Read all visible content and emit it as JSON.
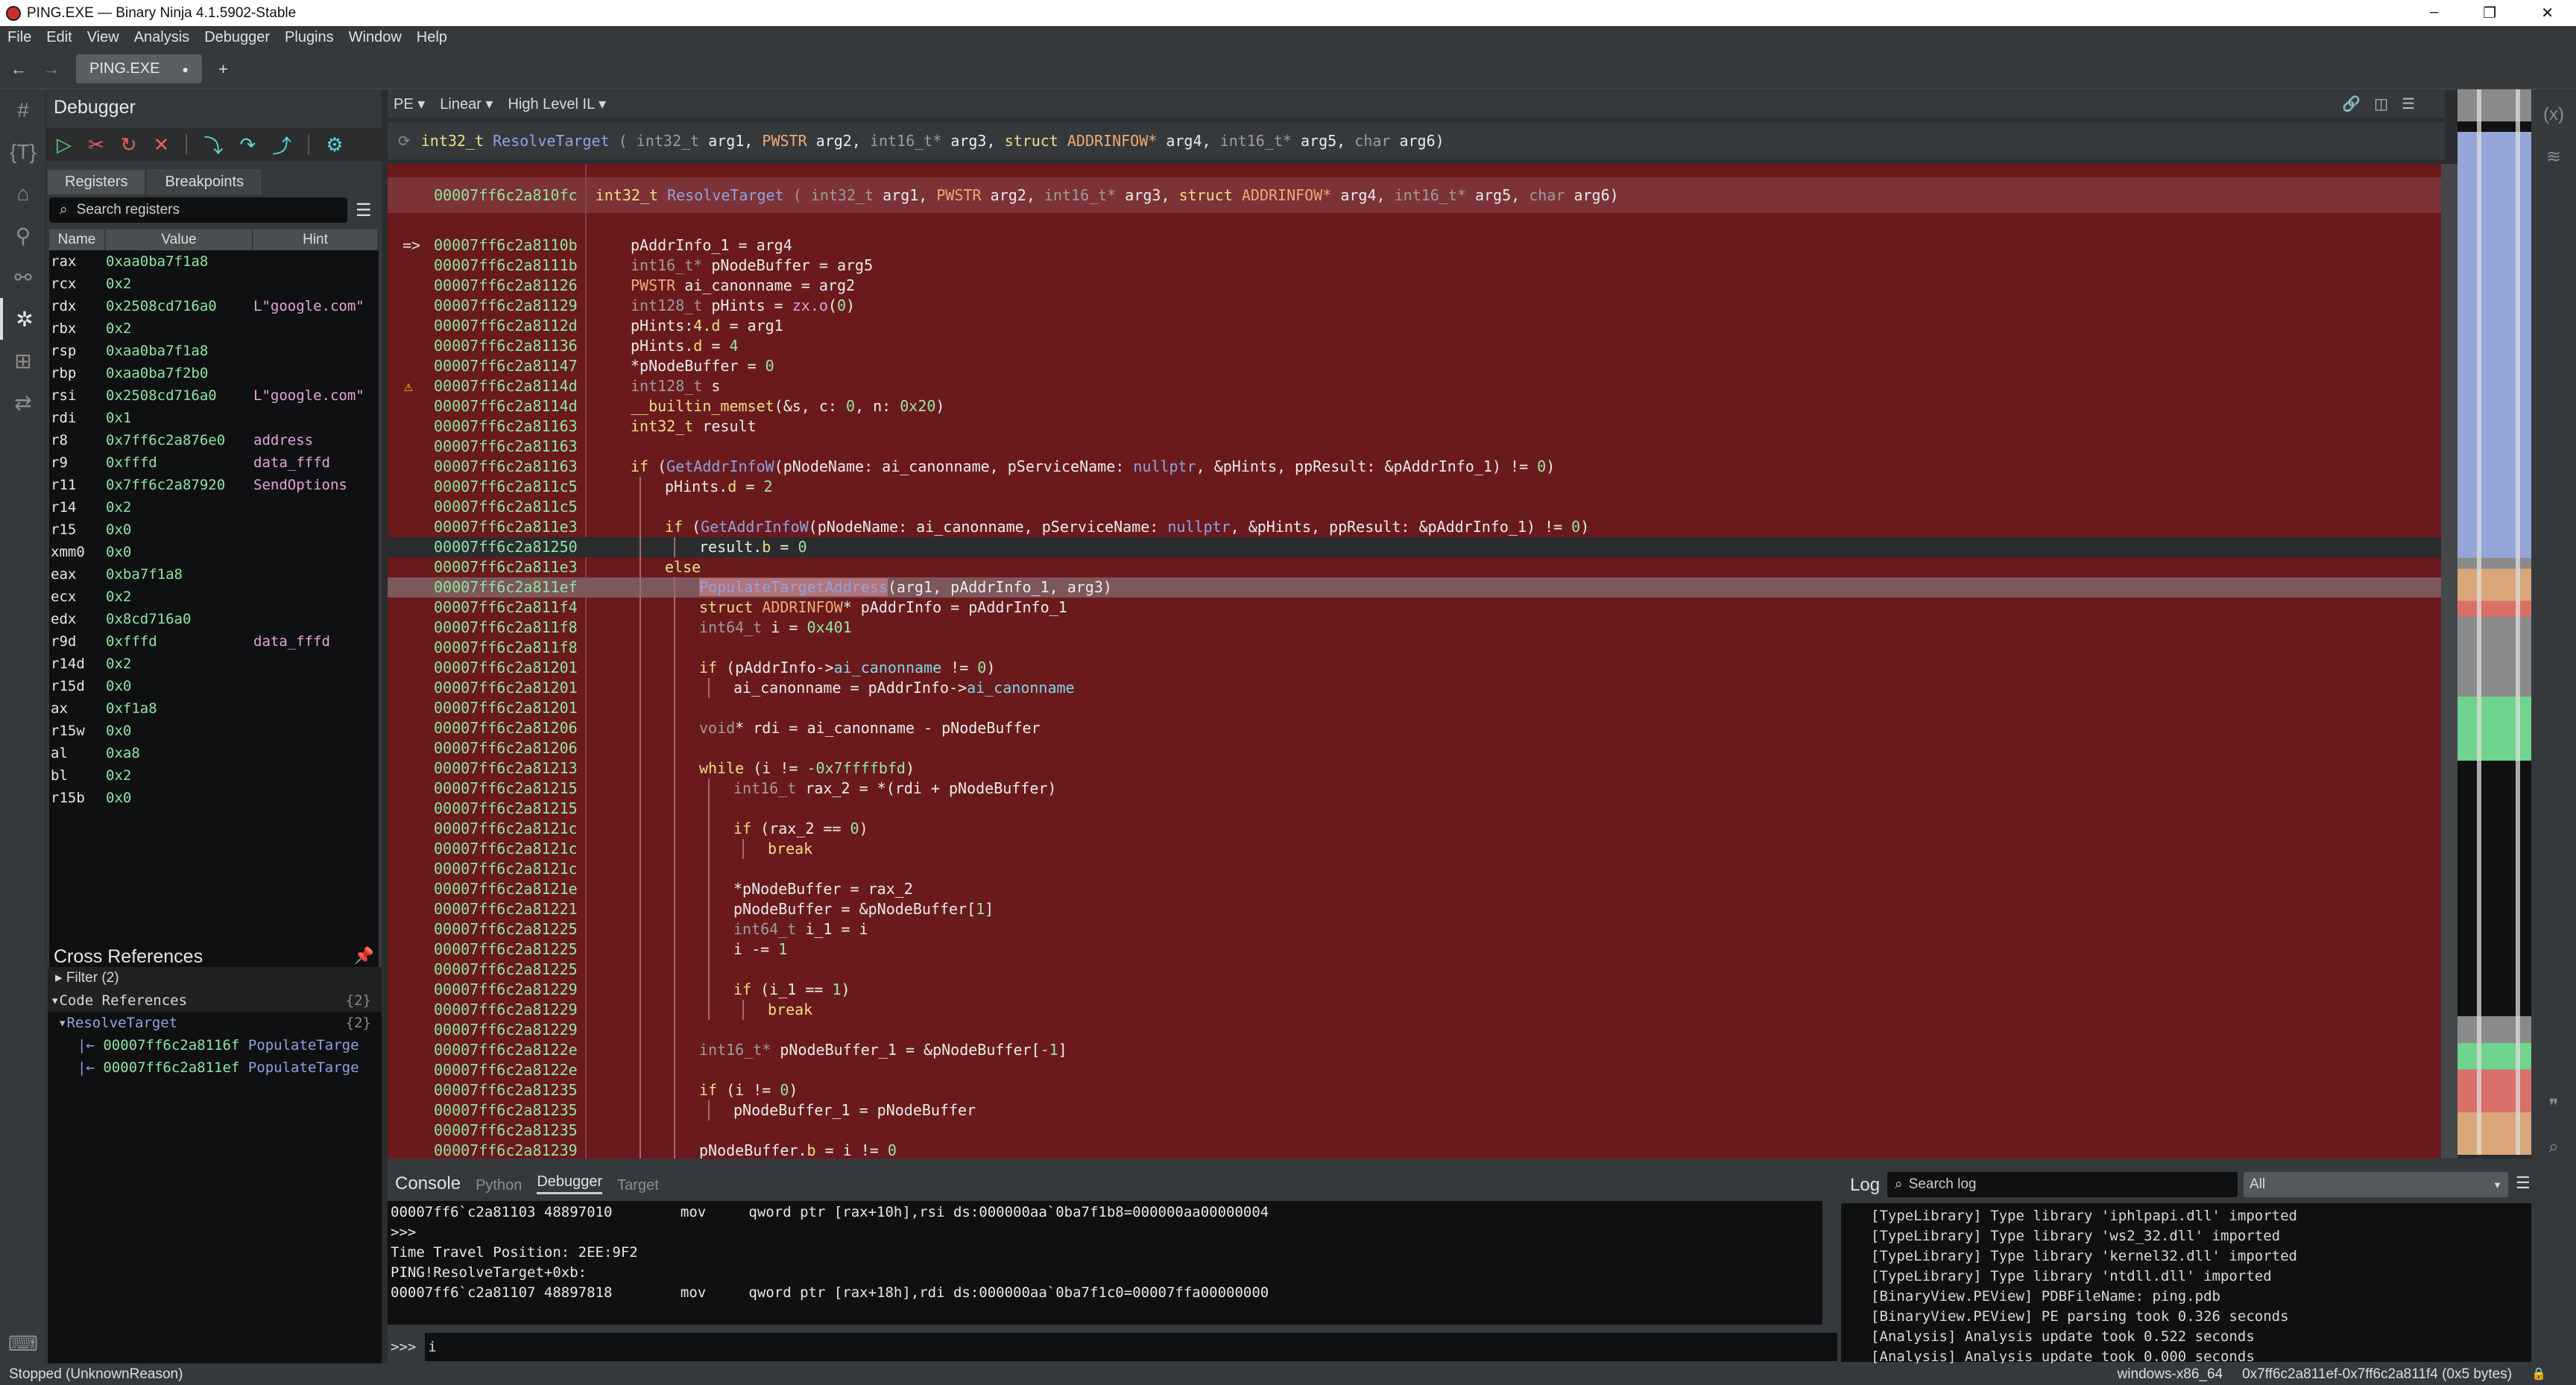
{
  "window": {
    "title": "PING.EXE — Binary Ninja 4.1.5902-Stable",
    "controls": [
      "–",
      "❐",
      "✕"
    ]
  },
  "menu": [
    "File",
    "Edit",
    "View",
    "Analysis",
    "Debugger",
    "Plugins",
    "Window",
    "Help"
  ],
  "tabs": {
    "back": "←",
    "forward": "→",
    "file_tab": "PING.EXE",
    "modified_dot": "●",
    "new_tab": "+"
  },
  "sidebar_icons": [
    "#",
    "{T}",
    "⌂",
    "⚲",
    "⚯",
    "✲",
    "⊞",
    "⇄"
  ],
  "debugger": {
    "title": "Debugger",
    "toolbar": [
      {
        "name": "resume",
        "glyph": "▷",
        "color": "#5fd07a"
      },
      {
        "name": "detach",
        "glyph": "✂",
        "color": "#e8625a"
      },
      {
        "name": "restart",
        "glyph": "↻",
        "color": "#e8625a"
      },
      {
        "name": "stop",
        "glyph": "✕",
        "color": "#e8625a"
      },
      {
        "name": "step-into",
        "glyph": "⤵",
        "color": "#58d8d8"
      },
      {
        "name": "step-over",
        "glyph": "↷",
        "color": "#58d8d8"
      },
      {
        "name": "step-return",
        "glyph": "⤴",
        "color": "#58d8d8"
      },
      {
        "name": "settings",
        "glyph": "⚙",
        "color": "#58d8d8"
      }
    ],
    "tabs": [
      "Registers",
      "Breakpoints"
    ],
    "search_placeholder": "Search registers",
    "columns": [
      "Name",
      "Value",
      "Hint"
    ],
    "registers": [
      [
        "rax",
        "0xaa0ba7f1a8",
        ""
      ],
      [
        "rcx",
        "0x2",
        ""
      ],
      [
        "rdx",
        "0x2508cd716a0",
        "L\"google.com\""
      ],
      [
        "rbx",
        "0x2",
        ""
      ],
      [
        "rsp",
        "0xaa0ba7f1a8",
        ""
      ],
      [
        "rbp",
        "0xaa0ba7f2b0",
        ""
      ],
      [
        "rsi",
        "0x2508cd716a0",
        "L\"google.com\""
      ],
      [
        "rdi",
        "0x1",
        ""
      ],
      [
        "r8",
        "0x7ff6c2a876e0",
        "address"
      ],
      [
        "r9",
        "0xfffd",
        "data_fffd"
      ],
      [
        "r11",
        "0x7ff6c2a87920",
        "SendOptions"
      ],
      [
        "r14",
        "0x2",
        ""
      ],
      [
        "r15",
        "0x0",
        ""
      ],
      [
        "xmm0",
        "0x0",
        ""
      ],
      [
        "eax",
        "0xba7f1a8",
        ""
      ],
      [
        "ecx",
        "0x2",
        ""
      ],
      [
        "edx",
        "0x8cd716a0",
        ""
      ],
      [
        "r9d",
        "0xfffd",
        "data_fffd"
      ],
      [
        "r14d",
        "0x2",
        ""
      ],
      [
        "r15d",
        "0x0",
        ""
      ],
      [
        "ax",
        "0xf1a8",
        ""
      ],
      [
        "r15w",
        "0x0",
        ""
      ],
      [
        "al",
        "0xa8",
        ""
      ],
      [
        "bl",
        "0x2",
        ""
      ],
      [
        "r15b",
        "0x0",
        ""
      ]
    ]
  },
  "xrefs": {
    "title": "Cross References",
    "filter": "Filter (2)",
    "code_refs": "Code References",
    "code_refs_count": "{2}",
    "function": "ResolveTarget",
    "function_count": "{2}",
    "items": [
      {
        "addr": "00007ff6c2a8116f",
        "name": "PopulateTarge"
      },
      {
        "addr": "00007ff6c2a811ef",
        "name": "PopulateTarge"
      }
    ]
  },
  "view": {
    "selectors": [
      "PE ▾",
      "Linear ▾",
      "High Level IL ▾"
    ],
    "signature": [
      [
        "k",
        "int32_t"
      ],
      [
        "f",
        "ResolveTarget"
      ],
      [
        "t",
        "("
      ],
      [
        "t",
        "int32_t"
      ],
      [
        "p",
        "arg1,"
      ],
      [
        "s",
        "PWSTR"
      ],
      [
        "p",
        "arg2,"
      ],
      [
        "t",
        "int16_t*"
      ],
      [
        "p",
        "arg3,"
      ],
      [
        "k",
        "struct"
      ],
      [
        "s",
        "ADDRINFOW*"
      ],
      [
        "p",
        "arg4,"
      ],
      [
        "t",
        "int16_t*"
      ],
      [
        "p",
        "arg5,"
      ],
      [
        "t",
        "char"
      ],
      [
        "p",
        "arg6)"
      ]
    ],
    "header_addr": "00007ff6c2a810fc",
    "colors": {
      "background": "#6a1a1d",
      "address": "#8ee5a2",
      "keyword": "#eedf86",
      "function": "#8fa3e2"
    }
  },
  "code": [
    {
      "a": "00007ff6c2a8110b",
      "i": 0,
      "mk": "=>",
      "tk": [
        [
          "p",
          "pAddrInfo_1 = arg4"
        ]
      ]
    },
    {
      "a": "00007ff6c2a8111b",
      "i": 0,
      "tk": [
        [
          "t",
          "int16_t* "
        ],
        [
          "p",
          "pNodeBuffer = arg5"
        ]
      ]
    },
    {
      "a": "00007ff6c2a81126",
      "i": 0,
      "tk": [
        [
          "s",
          "PWSTR "
        ],
        [
          "p",
          "ai_canonname = arg2"
        ]
      ]
    },
    {
      "a": "00007ff6c2a81129",
      "i": 0,
      "tk": [
        [
          "t",
          "int128_t "
        ],
        [
          "p",
          "pHints = "
        ],
        [
          "z",
          "zx.o"
        ],
        [
          "p",
          "("
        ],
        [
          "n",
          "0"
        ],
        [
          "p",
          ")"
        ]
      ]
    },
    {
      "a": "00007ff6c2a8112d",
      "i": 0,
      "tk": [
        [
          "p",
          "pHints:"
        ],
        [
          "m",
          "4.d"
        ],
        [
          "p",
          " = arg1"
        ]
      ]
    },
    {
      "a": "00007ff6c2a81136",
      "i": 0,
      "tk": [
        [
          "p",
          "pHints."
        ],
        [
          "m",
          "d"
        ],
        [
          "p",
          " = "
        ],
        [
          "n",
          "4"
        ]
      ]
    },
    {
      "a": "00007ff6c2a81147",
      "i": 0,
      "tk": [
        [
          "p",
          "*pNodeBuffer = "
        ],
        [
          "n",
          "0"
        ]
      ]
    },
    {
      "a": "00007ff6c2a8114d",
      "i": 0,
      "mk": "⚠",
      "tk": [
        [
          "t",
          "int128_t "
        ],
        [
          "p",
          "s"
        ]
      ]
    },
    {
      "a": "00007ff6c2a8114d",
      "i": 0,
      "tk": [
        [
          "k",
          "__builtin_memset"
        ],
        [
          "p",
          "(&s, c: "
        ],
        [
          "n",
          "0"
        ],
        [
          "p",
          ", n: "
        ],
        [
          "n",
          "0x20"
        ],
        [
          "p",
          ")"
        ]
      ]
    },
    {
      "a": "00007ff6c2a81163",
      "i": 0,
      "tk": [
        [
          "k",
          "int32_t "
        ],
        [
          "p",
          "result"
        ]
      ]
    },
    {
      "a": "00007ff6c2a81163",
      "i": 0,
      "tk": []
    },
    {
      "a": "00007ff6c2a81163",
      "i": 0,
      "tk": [
        [
          "k",
          "if "
        ],
        [
          "p",
          "("
        ],
        [
          "f",
          "GetAddrInfoW"
        ],
        [
          "p",
          "(pNodeName: ai_canonname, pServiceName: "
        ],
        [
          "f",
          "nullptr"
        ],
        [
          "p",
          ", &pHints, ppResult: &pAddrInfo_1) != "
        ],
        [
          "n",
          "0"
        ],
        [
          "p",
          ")"
        ]
      ]
    },
    {
      "a": "00007ff6c2a811c5",
      "i": 1,
      "tk": [
        [
          "p",
          "pHints."
        ],
        [
          "m",
          "d"
        ],
        [
          "p",
          " = "
        ],
        [
          "n",
          "2"
        ]
      ]
    },
    {
      "a": "00007ff6c2a811c5",
      "i": 1,
      "tk": []
    },
    {
      "a": "00007ff6c2a811e3",
      "i": 1,
      "tk": [
        [
          "k",
          "if "
        ],
        [
          "p",
          "("
        ],
        [
          "f",
          "GetAddrInfoW"
        ],
        [
          "p",
          "(pNodeName: ai_canonname, pServiceName: "
        ],
        [
          "f",
          "nullptr"
        ],
        [
          "p",
          ", &pHints, ppResult: &pAddrInfo_1) != "
        ],
        [
          "n",
          "0"
        ],
        [
          "p",
          ")"
        ]
      ]
    },
    {
      "a": "00007ff6c2a81250",
      "i": 2,
      "st": "cur",
      "tk": [
        [
          "p",
          "result."
        ],
        [
          "m",
          "b"
        ],
        [
          "p",
          " = "
        ],
        [
          "n",
          "0"
        ]
      ]
    },
    {
      "a": "00007ff6c2a811e3",
      "i": 1,
      "tk": [
        [
          "k",
          "else"
        ]
      ]
    },
    {
      "a": "00007ff6c2a811ef",
      "i": 2,
      "st": "sel",
      "tk": [
        [
          "f",
          "PopulateTargetAddress"
        ],
        [
          "p",
          "(arg1, pAddrInfo_1, arg3)"
        ]
      ]
    },
    {
      "a": "00007ff6c2a811f4",
      "i": 2,
      "tk": [
        [
          "k",
          "struct "
        ],
        [
          "s",
          "ADDRINFOW"
        ],
        [
          "p",
          "* pAddrInfo = pAddrInfo_1"
        ]
      ]
    },
    {
      "a": "00007ff6c2a811f8",
      "i": 2,
      "tk": [
        [
          "t",
          "int64_t "
        ],
        [
          "p",
          "i = "
        ],
        [
          "n",
          "0x401"
        ]
      ]
    },
    {
      "a": "00007ff6c2a811f8",
      "i": 2,
      "tk": []
    },
    {
      "a": "00007ff6c2a81201",
      "i": 2,
      "tk": [
        [
          "k",
          "if "
        ],
        [
          "p",
          "(pAddrInfo->"
        ],
        [
          "c",
          "ai_canonname"
        ],
        [
          "p",
          " != "
        ],
        [
          "n",
          "0"
        ],
        [
          "p",
          ")"
        ]
      ]
    },
    {
      "a": "00007ff6c2a81201",
      "i": 3,
      "tk": [
        [
          "p",
          "ai_canonname = pAddrInfo->"
        ],
        [
          "c",
          "ai_canonname"
        ]
      ]
    },
    {
      "a": "00007ff6c2a81201",
      "i": 2,
      "tk": []
    },
    {
      "a": "00007ff6c2a81206",
      "i": 2,
      "tk": [
        [
          "t",
          "void"
        ],
        [
          "p",
          "* rdi = ai_canonname - pNodeBuffer"
        ]
      ]
    },
    {
      "a": "00007ff6c2a81206",
      "i": 2,
      "tk": []
    },
    {
      "a": "00007ff6c2a81213",
      "i": 2,
      "tk": [
        [
          "k",
          "while "
        ],
        [
          "p",
          "(i != "
        ],
        [
          "n",
          "-0x7ffffbfd"
        ],
        [
          "p",
          ")"
        ]
      ]
    },
    {
      "a": "00007ff6c2a81215",
      "i": 3,
      "tk": [
        [
          "t",
          "int16_t "
        ],
        [
          "p",
          "rax_2 = *(rdi + pNodeBuffer)"
        ]
      ]
    },
    {
      "a": "00007ff6c2a81215",
      "i": 3,
      "tk": []
    },
    {
      "a": "00007ff6c2a8121c",
      "i": 3,
      "tk": [
        [
          "k",
          "if "
        ],
        [
          "p",
          "(rax_2 == "
        ],
        [
          "n",
          "0"
        ],
        [
          "p",
          ")"
        ]
      ]
    },
    {
      "a": "00007ff6c2a8121c",
      "i": 4,
      "tk": [
        [
          "k",
          "break"
        ]
      ]
    },
    {
      "a": "00007ff6c2a8121c",
      "i": 3,
      "tk": []
    },
    {
      "a": "00007ff6c2a8121e",
      "i": 3,
      "tk": [
        [
          "p",
          "*pNodeBuffer = rax_2"
        ]
      ]
    },
    {
      "a": "00007ff6c2a81221",
      "i": 3,
      "tk": [
        [
          "p",
          "pNodeBuffer = &pNodeBuffer["
        ],
        [
          "n",
          "1"
        ],
        [
          "p",
          "]"
        ]
      ]
    },
    {
      "a": "00007ff6c2a81225",
      "i": 3,
      "tk": [
        [
          "t",
          "int64_t "
        ],
        [
          "p",
          "i_1 = i"
        ]
      ]
    },
    {
      "a": "00007ff6c2a81225",
      "i": 3,
      "tk": [
        [
          "p",
          "i -= "
        ],
        [
          "n",
          "1"
        ]
      ]
    },
    {
      "a": "00007ff6c2a81225",
      "i": 3,
      "tk": []
    },
    {
      "a": "00007ff6c2a81229",
      "i": 3,
      "tk": [
        [
          "k",
          "if "
        ],
        [
          "p",
          "(i_1 == "
        ],
        [
          "n",
          "1"
        ],
        [
          "p",
          ")"
        ]
      ]
    },
    {
      "a": "00007ff6c2a81229",
      "i": 4,
      "tk": [
        [
          "k",
          "break"
        ]
      ]
    },
    {
      "a": "00007ff6c2a81229",
      "i": 2,
      "tk": []
    },
    {
      "a": "00007ff6c2a8122e",
      "i": 2,
      "tk": [
        [
          "t",
          "int16_t* "
        ],
        [
          "p",
          "pNodeBuffer_1 = &pNodeBuffer["
        ],
        [
          "n",
          "-1"
        ],
        [
          "p",
          "]"
        ]
      ]
    },
    {
      "a": "00007ff6c2a8122e",
      "i": 2,
      "tk": []
    },
    {
      "a": "00007ff6c2a81235",
      "i": 2,
      "tk": [
        [
          "k",
          "if "
        ],
        [
          "p",
          "(i != "
        ],
        [
          "n",
          "0"
        ],
        [
          "p",
          ")"
        ]
      ]
    },
    {
      "a": "00007ff6c2a81235",
      "i": 3,
      "tk": [
        [
          "p",
          "pNodeBuffer_1 = pNodeBuffer"
        ]
      ]
    },
    {
      "a": "00007ff6c2a81235",
      "i": 2,
      "tk": []
    },
    {
      "a": "00007ff6c2a81239",
      "i": 2,
      "tk": [
        [
          "p",
          "pNodeBuffer."
        ],
        [
          "m",
          "b"
        ],
        [
          "p",
          " = i != "
        ],
        [
          "n",
          "0"
        ]
      ]
    }
  ],
  "console": {
    "title": "Console",
    "tabs": [
      "Python",
      "Debugger",
      "Target"
    ],
    "active_tab": "Debugger",
    "lines": [
      "00007ff6`c2a81103 48897010        mov     qword ptr [rax+10h],rsi ds:000000aa`0ba7f1b8=000000aa00000004",
      ">>>",
      "Time Travel Position: 2EE:9F2",
      "PING!ResolveTarget+0xb:",
      "00007ff6`c2a81107 48897818        mov     qword ptr [rax+18h],rdi ds:000000aa`0ba7f1c0=00007ffa00000000"
    ],
    "prompt": ">>>",
    "input": "i"
  },
  "log": {
    "title": "Log",
    "search_placeholder": "Search log",
    "filter": "All",
    "lines": [
      "[TypeLibrary] Type library 'iphlpapi.dll' imported",
      "[TypeLibrary] Type library 'ws2_32.dll' imported",
      "[TypeLibrary] Type library 'kernel32.dll' imported",
      "[TypeLibrary] Type library 'ntdll.dll' imported",
      "[BinaryView.PEView] PDBFileName: ping.pdb",
      "[BinaryView.PEView] PE parsing took 0.326 seconds",
      "[Analysis] Analysis update took 0.522 seconds",
      "[Analysis] Analysis update took 0.000 seconds"
    ]
  },
  "right_icons": [
    "(x)",
    "≋",
    "❞",
    "⌕",
    "☰",
    "◷",
    "⚙",
    "≣"
  ],
  "status": {
    "left": "Stopped (UnknownReason)",
    "platform": "windows-x86_64",
    "selection": "0x7ff6c2a811ef-0x7ff6c2a811f4 (0x5 bytes)",
    "lock": "🔒"
  }
}
